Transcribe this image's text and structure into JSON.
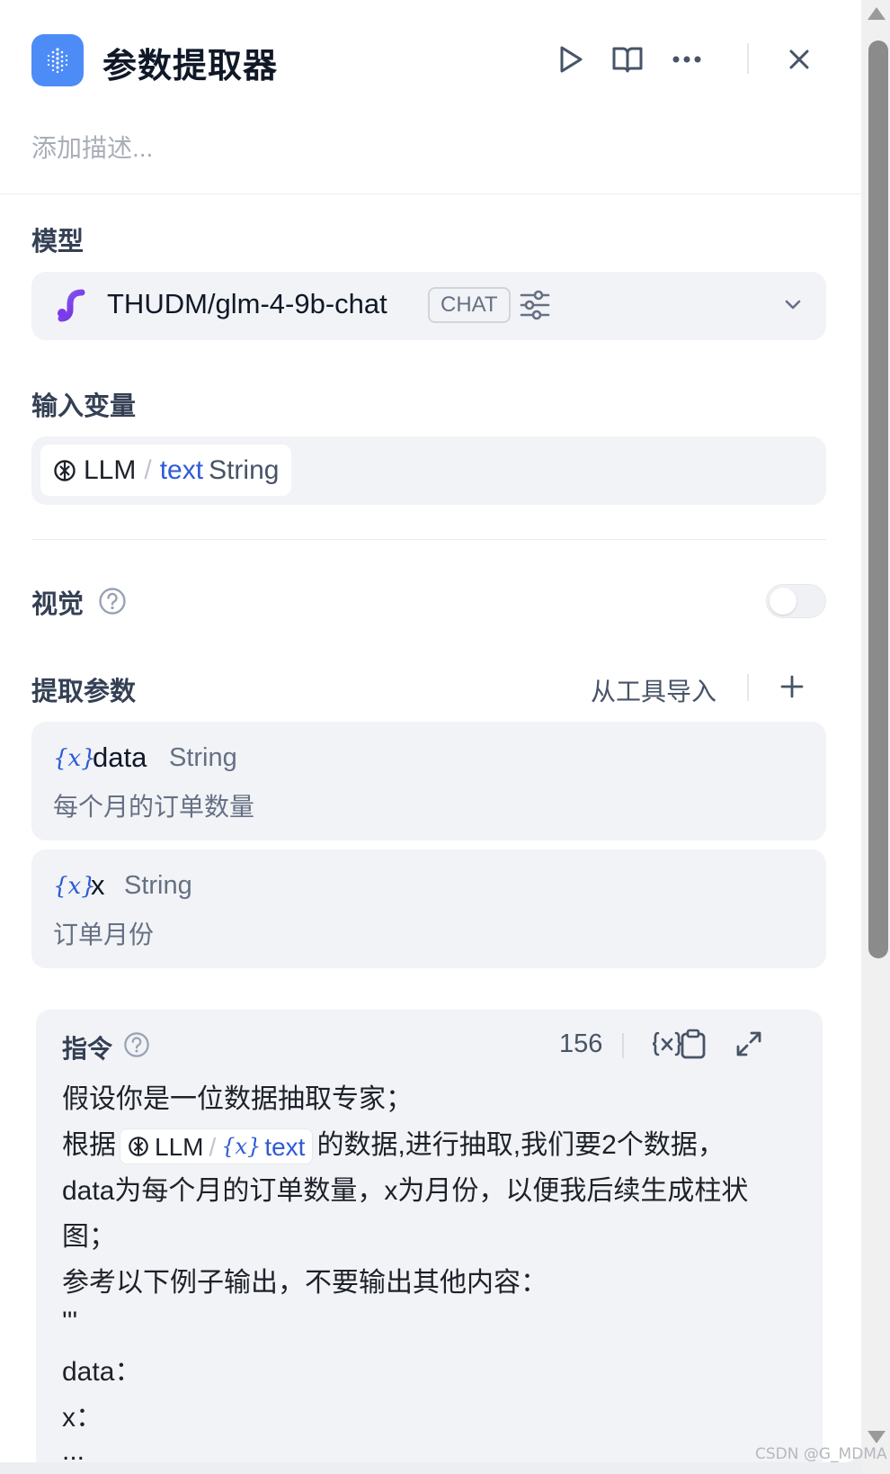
{
  "header": {
    "title": "参数提取器",
    "description_placeholder": "添加描述..."
  },
  "model": {
    "section_label": "模型",
    "name": "THUDM/glm-4-9b-chat",
    "badge": "CHAT"
  },
  "input_vars": {
    "section_label": "输入变量",
    "node": "LLM",
    "separator": "/",
    "variable": "text",
    "type": "String"
  },
  "vision": {
    "label": "视觉",
    "enabled": false
  },
  "extract_params": {
    "section_label": "提取参数",
    "import_label": "从工具导入",
    "var_icon": "{x}",
    "items": [
      {
        "name": "data",
        "type": "String",
        "description": "每个月的订单数量"
      },
      {
        "name": "x",
        "type": "String",
        "description": "订单月份"
      }
    ]
  },
  "instruction": {
    "label": "指令",
    "char_count": "156",
    "var_icon": "{x}",
    "line1": "假设你是一位数据抽取专家；",
    "line2_prefix": "根据",
    "line2_node": "LLM",
    "line2_separator": "/",
    "line2_var": "text",
    "line2_suffix": "的数据,进行抽取,我们要2个数据，",
    "line3": "data为每个月的订单数量，x为月份，以便我后续生成柱状",
    "line4": "图；",
    "line5": "参考以下例子输出，不要输出其他内容：",
    "line6": "'''",
    "line7": "data：",
    "line8": "x：",
    "line9": "..."
  },
  "watermark": "CSDN @G_MDMA"
}
